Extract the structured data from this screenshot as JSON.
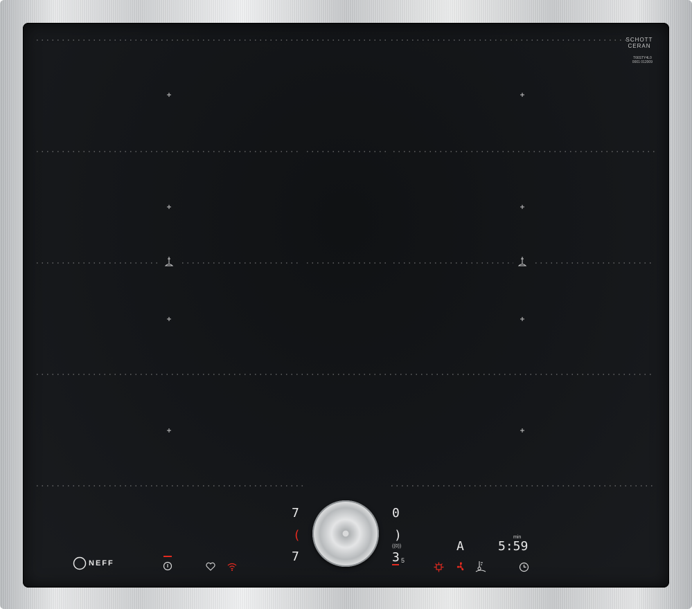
{
  "brand": {
    "manufacturer": "NEFF",
    "glass_maker_line1": "SCHOTT",
    "glass_maker_line2": "CERAN",
    "model_line1": "T66STY4L0",
    "model_line2": "0001 012009"
  },
  "left_controls": {
    "top_level": "7",
    "mid_indicator": "(",
    "bottom_level": "7"
  },
  "right_controls": {
    "top_level": "0",
    "mid_indicator": ")",
    "bottom_level": "3",
    "bottom_level_decimal": "5",
    "bottom_level_label": "((0))"
  },
  "display": {
    "mode": "A",
    "timer_value": "5:59",
    "timer_unit": "min"
  },
  "icons": {
    "power": "power-icon",
    "favourite": "heart-icon",
    "wifi": "wifi-icon",
    "flex_zone": "flex-zone-icon",
    "fan": "fan-icon",
    "temp_sensor": "thermometer-icon",
    "timer": "clock-icon"
  },
  "colors": {
    "glass": "#15171a",
    "frame": "#d2d4d6",
    "indicator_red": "#e32a1f",
    "display_white": "#e9e9e9"
  }
}
